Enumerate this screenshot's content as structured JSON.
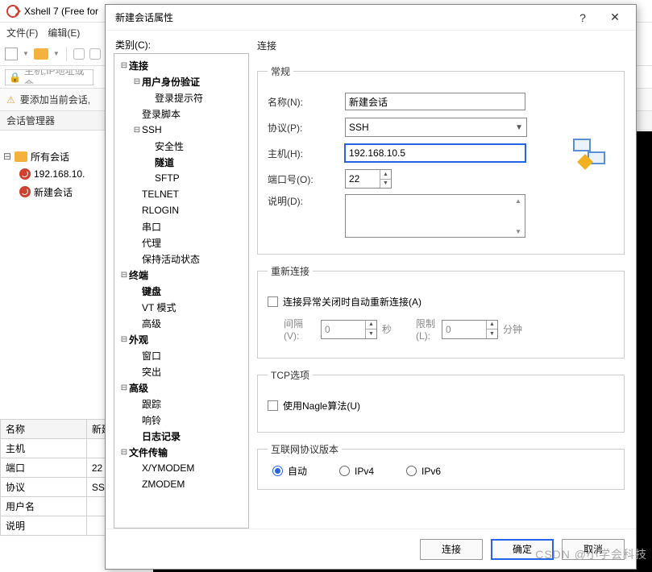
{
  "app": {
    "title": "Xshell 7 (Free for"
  },
  "menubar": [
    "文件(F)",
    "编辑(E)"
  ],
  "addr": {
    "placeholder": "主机,IP地址或会"
  },
  "notice": "要添加当前会话,",
  "panel_header": "会话管理器",
  "bg_tree": {
    "root": "所有会话",
    "items": [
      "192.168.10.",
      "新建会话"
    ]
  },
  "prop_table": {
    "headers": [
      "名称",
      "新建"
    ],
    "rows": [
      [
        "主机",
        ""
      ],
      [
        "端口",
        "22"
      ],
      [
        "协议",
        "SSH"
      ],
      [
        "用户名",
        ""
      ],
      [
        "说明",
        ""
      ]
    ]
  },
  "dialog": {
    "title": "新建会话属性",
    "help": "?",
    "close": "✕",
    "category_label": "类别(C):",
    "tree": [
      {
        "lvl": 0,
        "exp": "⊟",
        "label": "连接",
        "bold": true
      },
      {
        "lvl": 1,
        "exp": "⊟",
        "label": "用户身份验证",
        "bold": true
      },
      {
        "lvl": 2,
        "exp": "",
        "label": "登录提示符",
        "bold": false
      },
      {
        "lvl": 1,
        "exp": "",
        "label": "登录脚本",
        "bold": false
      },
      {
        "lvl": 1,
        "exp": "⊟",
        "label": "SSH",
        "bold": false
      },
      {
        "lvl": 2,
        "exp": "",
        "label": "安全性",
        "bold": false
      },
      {
        "lvl": 2,
        "exp": "",
        "label": "隧道",
        "bold": true
      },
      {
        "lvl": 2,
        "exp": "",
        "label": "SFTP",
        "bold": false
      },
      {
        "lvl": 1,
        "exp": "",
        "label": "TELNET",
        "bold": false
      },
      {
        "lvl": 1,
        "exp": "",
        "label": "RLOGIN",
        "bold": false
      },
      {
        "lvl": 1,
        "exp": "",
        "label": "串口",
        "bold": false
      },
      {
        "lvl": 1,
        "exp": "",
        "label": "代理",
        "bold": false
      },
      {
        "lvl": 1,
        "exp": "",
        "label": "保持活动状态",
        "bold": false
      },
      {
        "lvl": 0,
        "exp": "⊟",
        "label": "终端",
        "bold": true
      },
      {
        "lvl": 1,
        "exp": "",
        "label": "键盘",
        "bold": true
      },
      {
        "lvl": 1,
        "exp": "",
        "label": "VT 模式",
        "bold": false
      },
      {
        "lvl": 1,
        "exp": "",
        "label": "高级",
        "bold": false
      },
      {
        "lvl": 0,
        "exp": "⊟",
        "label": "外观",
        "bold": true
      },
      {
        "lvl": 1,
        "exp": "",
        "label": "窗口",
        "bold": false
      },
      {
        "lvl": 1,
        "exp": "",
        "label": "突出",
        "bold": false
      },
      {
        "lvl": 0,
        "exp": "⊟",
        "label": "高级",
        "bold": true
      },
      {
        "lvl": 1,
        "exp": "",
        "label": "跟踪",
        "bold": false
      },
      {
        "lvl": 1,
        "exp": "",
        "label": "响铃",
        "bold": false
      },
      {
        "lvl": 1,
        "exp": "",
        "label": "日志记录",
        "bold": true
      },
      {
        "lvl": 0,
        "exp": "⊟",
        "label": "文件传输",
        "bold": true
      },
      {
        "lvl": 1,
        "exp": "",
        "label": "X/YMODEM",
        "bold": false
      },
      {
        "lvl": 1,
        "exp": "",
        "label": "ZMODEM",
        "bold": false
      }
    ],
    "right": {
      "section": "连接",
      "general": {
        "legend": "常规",
        "name_label": "名称(N):",
        "name_value": "新建会话",
        "proto_label": "协议(P):",
        "proto_value": "SSH",
        "host_label": "主机(H):",
        "host_value": "192.168.10.5",
        "port_label": "端口号(O):",
        "port_value": "22",
        "desc_label": "说明(D):"
      },
      "reconnect": {
        "legend": "重新连接",
        "auto_label": "连接异常关闭时自动重新连接(A)",
        "interval_label": "间隔(V):",
        "interval_value": "0",
        "interval_unit": "秒",
        "limit_label": "限制(L):",
        "limit_value": "0",
        "limit_unit": "分钟"
      },
      "tcp": {
        "legend": "TCP选项",
        "nagle_label": "使用Nagle算法(U)"
      },
      "ipver": {
        "legend": "互联网协议版本",
        "auto": "自动",
        "ipv4": "IPv4",
        "ipv6": "IPv6"
      }
    },
    "footer": {
      "connect": "连接",
      "ok": "确定",
      "cancel": "取消"
    }
  },
  "watermark": "CSDN @小学会科技"
}
